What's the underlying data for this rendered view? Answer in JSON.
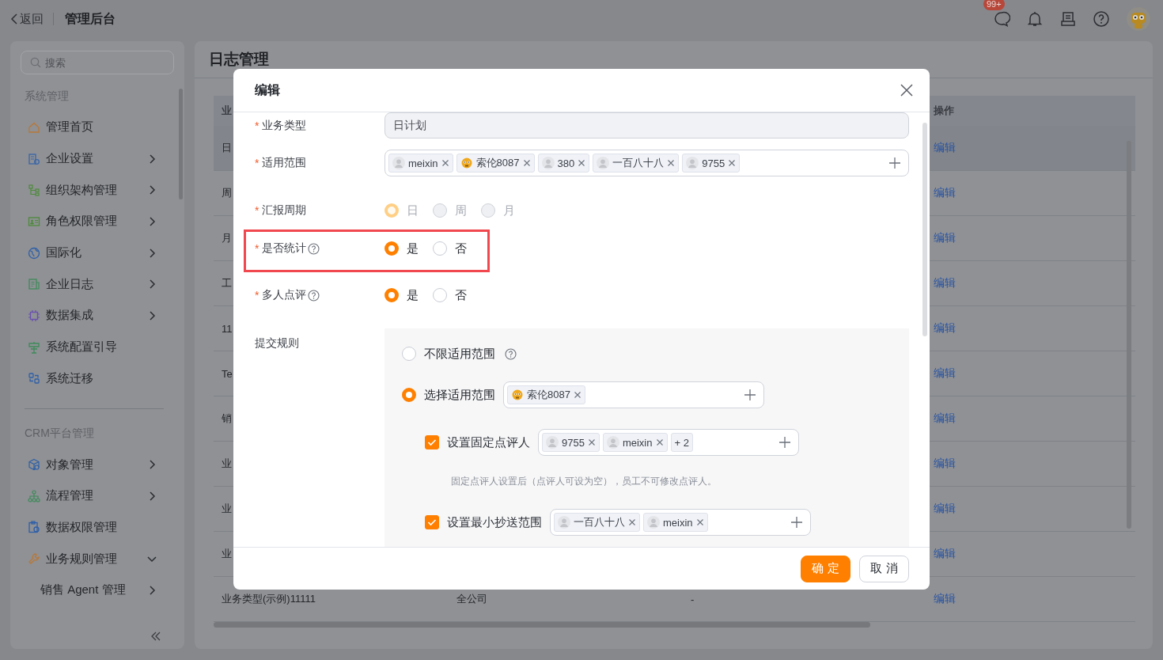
{
  "topbar": {
    "back": "返回",
    "title": "管理后台",
    "badge": "99+"
  },
  "sidebar": {
    "search_placeholder": "搜索",
    "sections": [
      {
        "title": "系统管理",
        "items": [
          {
            "label": "管理首页",
            "kind": "link"
          },
          {
            "label": "企业设置",
            "kind": "group",
            "expanded": false
          },
          {
            "label": "组织架构管理",
            "kind": "group",
            "expanded": false
          },
          {
            "label": "角色权限管理",
            "kind": "group",
            "expanded": false
          },
          {
            "label": "国际化",
            "kind": "group",
            "expanded": false
          },
          {
            "label": "企业日志",
            "kind": "group",
            "expanded": false
          },
          {
            "label": "数据集成",
            "kind": "group",
            "expanded": false
          },
          {
            "label": "系统配置引导",
            "kind": "link"
          },
          {
            "label": "系统迁移",
            "kind": "link"
          }
        ]
      },
      {
        "title": "CRM平台管理",
        "items": [
          {
            "label": "对象管理",
            "kind": "group",
            "expanded": false
          },
          {
            "label": "流程管理",
            "kind": "group",
            "expanded": false
          },
          {
            "label": "数据权限管理",
            "kind": "link"
          },
          {
            "label": "业务规则管理",
            "kind": "group",
            "expanded": true,
            "children": [
              {
                "label": "销售 Agent 管理",
                "kind": "group",
                "expanded": false
              }
            ]
          }
        ]
      }
    ]
  },
  "page": {
    "title": "日志管理",
    "table": {
      "columns": [
        "业",
        "操作"
      ],
      "rows": [
        {
          "name": "日",
          "action": "编辑",
          "selected": true
        },
        {
          "name": "周",
          "action": "编辑",
          "selected": false
        },
        {
          "name": "月",
          "action": "编辑",
          "selected": false
        },
        {
          "name": "工",
          "action": "编辑",
          "selected": false
        },
        {
          "name": "11",
          "action": "编辑",
          "selected": false
        },
        {
          "name": "Te",
          "action": "编辑",
          "selected": false
        },
        {
          "name": "销",
          "action": "编辑",
          "selected": false
        },
        {
          "name": "业",
          "action": "编辑",
          "selected": false
        },
        {
          "name": "业",
          "action": "编辑",
          "selected": false
        },
        {
          "name": "业",
          "action": "编辑",
          "selected": false
        },
        {
          "name": "业务类型(示例)11111",
          "scope": "全公司",
          "column_3": "-",
          "action": "编辑",
          "selected": false
        }
      ]
    }
  },
  "dialog": {
    "title": "编辑",
    "fields": [
      {
        "label": "业务类型",
        "mark": "*",
        "kind": "readonly",
        "value": "日计划"
      },
      {
        "label": "适用范围",
        "mark": "*",
        "kind": "tags",
        "tags": [
          {
            "text": "meixin",
            "kind": "person"
          },
          {
            "text": "索伦8087",
            "kind": "robot"
          },
          {
            "text": "380",
            "kind": "person"
          },
          {
            "text": "一百八十八",
            "kind": "person"
          },
          {
            "text": "9755",
            "kind": "person"
          }
        ]
      },
      {
        "label": "汇报周期",
        "mark": "*",
        "kind": "radio",
        "options": [
          {
            "label": "日",
            "selected": true,
            "disabled": true
          },
          {
            "label": "周",
            "selected": false,
            "disabled": true
          },
          {
            "label": "月",
            "selected": false,
            "disabled": true
          }
        ]
      },
      {
        "label": "是否统计",
        "mark": "*",
        "kind": "radio",
        "help": true,
        "highlighted": true,
        "options": [
          {
            "label": "是",
            "selected": true,
            "disabled": false
          },
          {
            "label": "否",
            "selected": false,
            "disabled": false
          }
        ]
      },
      {
        "label": "多人点评",
        "mark": "*",
        "kind": "radio",
        "help": true,
        "options": [
          {
            "label": "是",
            "selected": true,
            "disabled": false
          },
          {
            "label": "否",
            "selected": false,
            "disabled": false
          }
        ]
      },
      {
        "label": "提交规则",
        "kind": "rules",
        "options": [
          {
            "label": "不限适用范围",
            "selected": false,
            "help": true
          },
          {
            "label": "选择适用范围",
            "selected": true,
            "tags": [
              {
                "text": "索伦8087",
                "kind": "robot"
              }
            ]
          }
        ],
        "settings": [
          {
            "label": "设置固定点评人",
            "checked": true,
            "tags": [
              {
                "text": "9755",
                "kind": "person"
              },
              {
                "text": "meixin",
                "kind": "person"
              }
            ],
            "more": "+ 2",
            "hint": "固定点评人设置后（点评人可设为空），员工不可修改点评人。"
          },
          {
            "label": "设置最小抄送范围",
            "checked": true,
            "tags": [
              {
                "text": "一百八十八",
                "kind": "person"
              },
              {
                "text": "meixin",
                "kind": "person"
              }
            ]
          }
        ]
      }
    ],
    "buttons": [
      {
        "label": "确 定",
        "kind": "primary"
      },
      {
        "label": "取 消",
        "kind": "default"
      }
    ]
  }
}
